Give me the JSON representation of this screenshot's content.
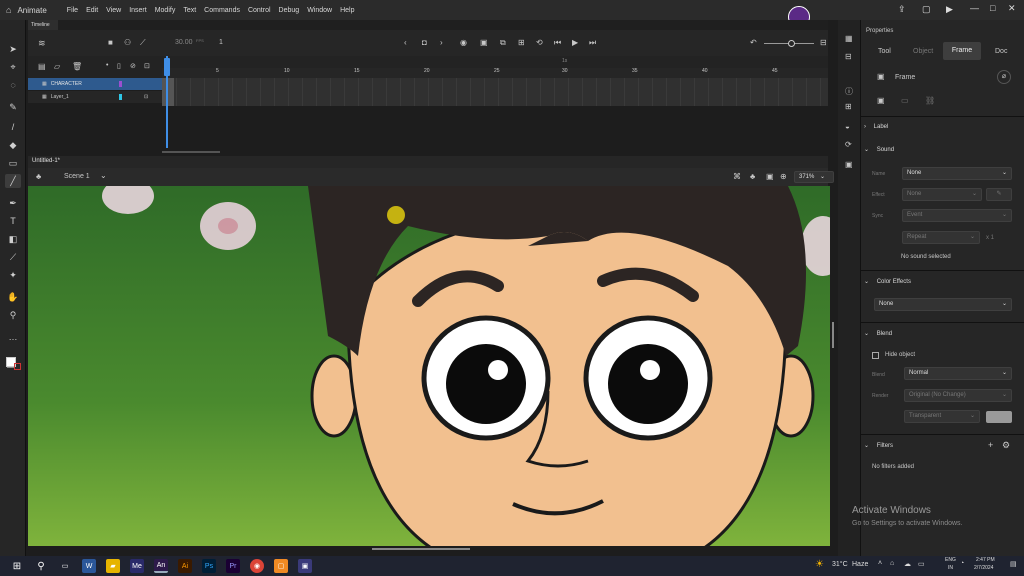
{
  "menu": {
    "app": "Animate",
    "items": [
      "File",
      "Edit",
      "View",
      "Insert",
      "Modify",
      "Text",
      "Commands",
      "Control",
      "Debug",
      "Window",
      "Help"
    ]
  },
  "timeline": {
    "tab_label": "Timeline",
    "fps": "30.00",
    "fps_unit": "FPS",
    "frame": "1",
    "ruler": [
      "5",
      "10",
      "15",
      "20",
      "25",
      "30",
      "35",
      "40",
      "45"
    ],
    "ruler_sec": "1s",
    "layers": [
      {
        "name": "CHARACTER",
        "color": "#9a4fd0"
      },
      {
        "name": "Layer_1",
        "color": "#2ec6e6"
      }
    ]
  },
  "document": {
    "tab": "Untitled-1*",
    "scene": "Scene 1",
    "zoom": "371%"
  },
  "properties": {
    "title": "Properties",
    "tabs": [
      "Tool",
      "Object",
      "Frame",
      "Doc"
    ],
    "active_tab": "Frame",
    "frame_label": "Frame",
    "label_section": "Label",
    "sound_section": "Sound",
    "sound_name_label": "Name",
    "sound_name_value": "None",
    "effect_label": "Effect",
    "effect_value": "None",
    "sync_label": "Sync",
    "sync_value": "Event",
    "repeat_value": "Repeat",
    "repeat_count": "x 1",
    "no_sound": "No sound selected",
    "color_effects": "Color Effects",
    "color_effects_value": "None",
    "blend_section": "Blend",
    "hide_object": "Hide object",
    "blend_label": "Blend",
    "blend_value": "Normal",
    "render_label": "Render",
    "render_value": "Original (No Change)",
    "transparent_value": "Transparent",
    "filters": "Filters",
    "no_filters": "No filters added"
  },
  "watermark": {
    "line1": "Activate Windows",
    "line2": "Go to Settings to activate Windows."
  },
  "taskbar": {
    "weather_temp": "31°C",
    "weather_text": "Haze",
    "lang1": "ENG",
    "lang2": "IN",
    "time": "2:47 PM",
    "date": "2/7/2024"
  }
}
